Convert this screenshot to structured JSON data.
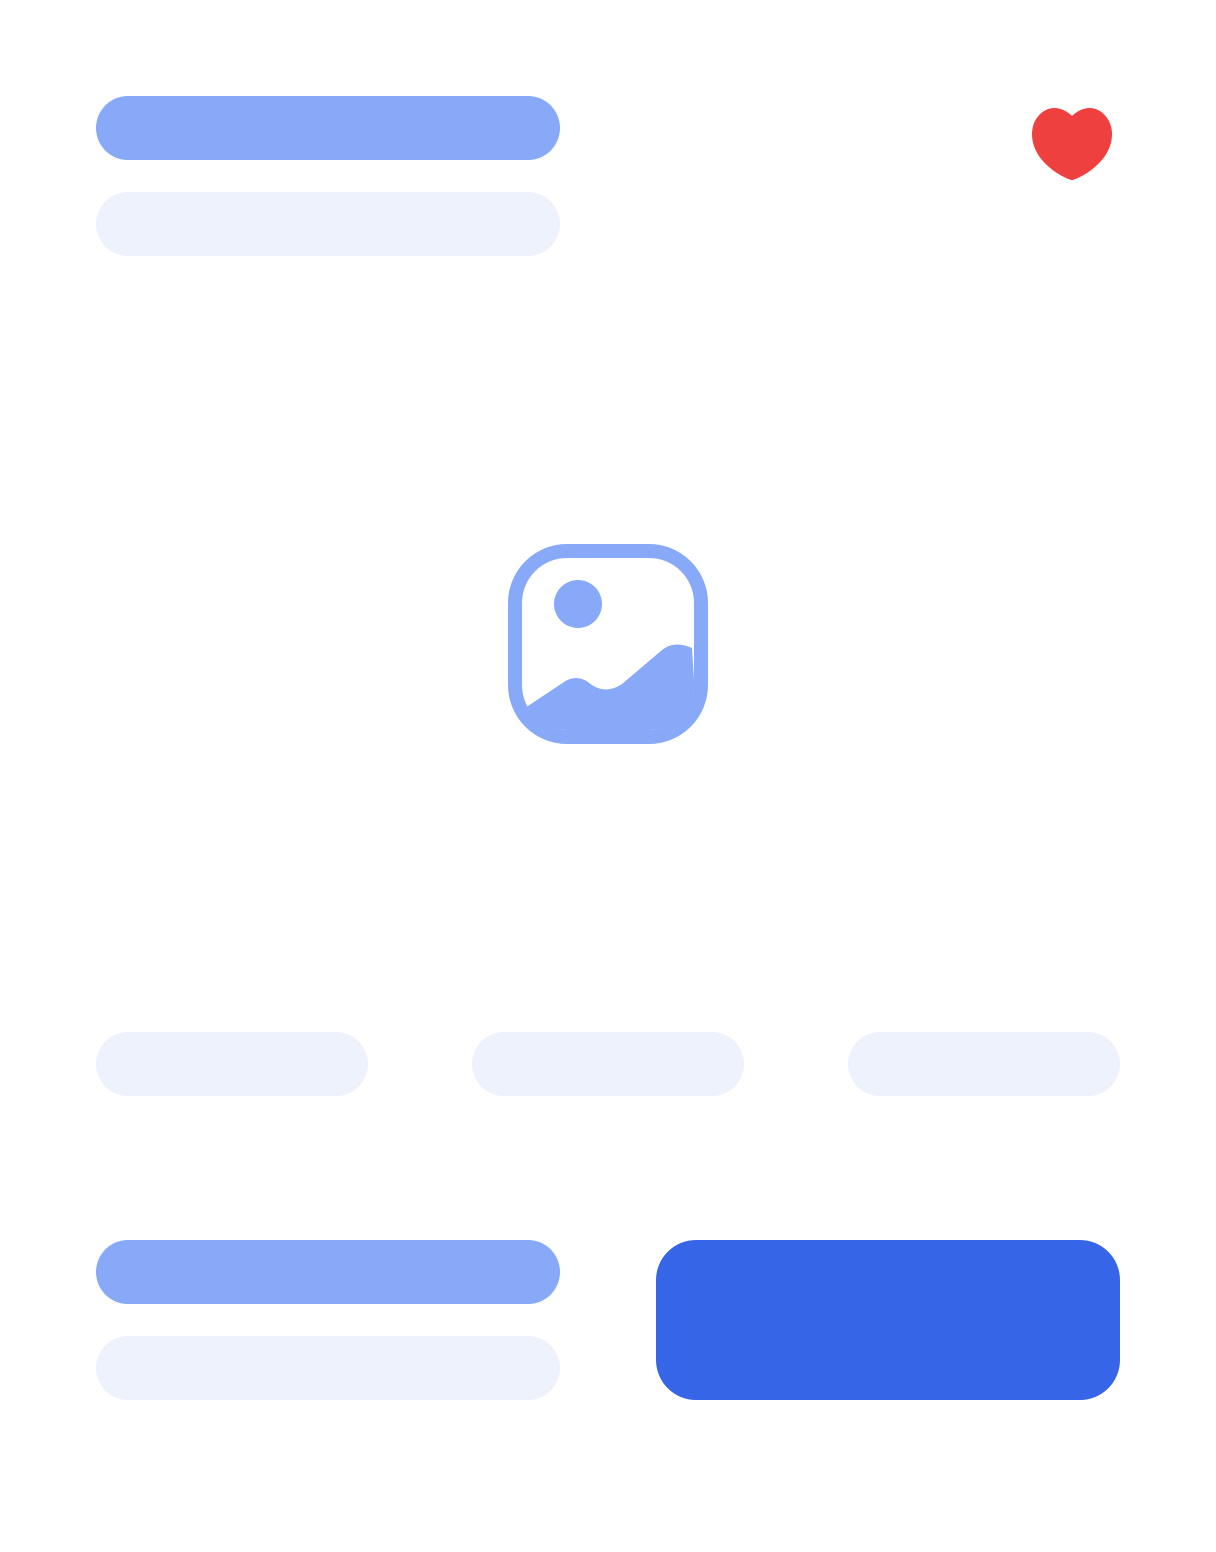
{
  "colors": {
    "accent_light": "#88a9f8",
    "muted": "#edf2fc",
    "primary": "#3665e8",
    "favorite": "#ef4040",
    "background": "#ffffff"
  },
  "icons": {
    "favorite": "heart-icon",
    "media": "image-placeholder-icon"
  },
  "header": {
    "title": "",
    "subtitle": ""
  },
  "chips": [
    "",
    "",
    ""
  ],
  "footer": {
    "price": "",
    "meta": "",
    "cta_label": ""
  }
}
